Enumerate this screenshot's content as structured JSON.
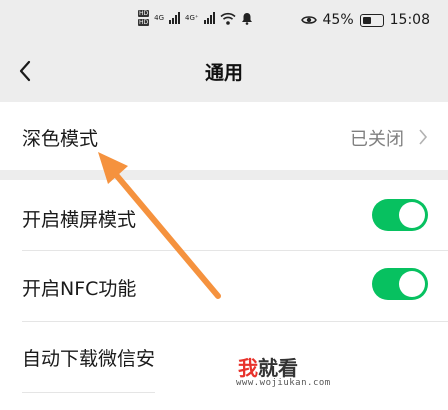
{
  "status_bar": {
    "hd_badges": [
      "HD",
      "HD"
    ],
    "network_labels": [
      "4G",
      "4G⁺"
    ],
    "battery_percent": "45%",
    "time": "15:08",
    "icons": [
      "signal-icon",
      "wifi-icon",
      "notification-bell-icon",
      "eye-icon",
      "battery-icon"
    ]
  },
  "nav": {
    "title": "通用",
    "back_icon": "chevron-left-icon"
  },
  "settings": {
    "dark_mode": {
      "label": "深色模式",
      "value": "已关闭"
    },
    "landscape": {
      "label": "开启横屏模式",
      "enabled": true
    },
    "nfc": {
      "label": "开启NFC功能",
      "enabled": true
    },
    "auto_download": {
      "label": "自动下载微信安"
    }
  },
  "watermark": {
    "logo_red": "我",
    "logo_rest": "就看",
    "url": "www.wojiukan.com"
  },
  "colors": {
    "toggle_on": "#07c160",
    "arrow": "#f5923e",
    "background": "#ededed"
  }
}
